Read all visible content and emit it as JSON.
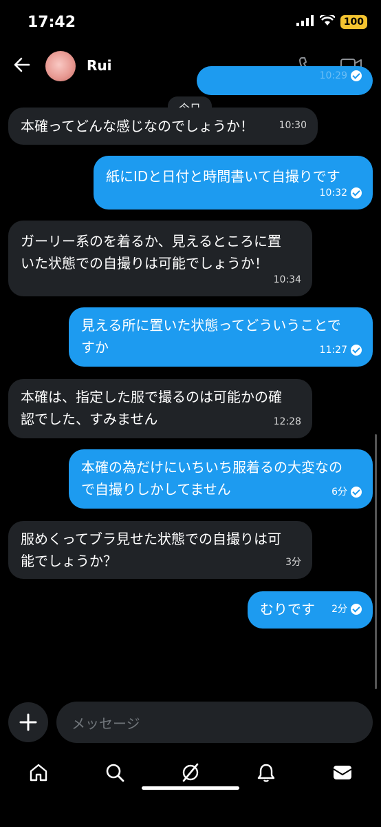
{
  "status_bar": {
    "time": "17:42",
    "battery": "100"
  },
  "header": {
    "contact_name": "Rui"
  },
  "date_divider": "今日",
  "messages": [
    {
      "direction": "out",
      "text": "",
      "time": "10:29",
      "partial": true
    },
    {
      "direction": "in",
      "lines": [
        "本確ってどんな感じなのでしょうか！"
      ],
      "time": "10:30"
    },
    {
      "direction": "out",
      "lines": [
        "紙にIDと日付と時間書いて自撮りです"
      ],
      "time": "10:32",
      "read": true
    },
    {
      "direction": "in",
      "lines": [
        "ガーリー系のを着るか、見えるところに置",
        "いた状態での自撮りは可能でしょうか！"
      ],
      "time": "10:34"
    },
    {
      "direction": "out",
      "lines": [
        "見える所に置いた状態ってどういうことで",
        "すか"
      ],
      "time": "11:27",
      "read": true
    },
    {
      "direction": "in",
      "lines": [
        "本確は、指定した服で撮るのは可能かの確",
        "認でした、すみません"
      ],
      "time": "12:28"
    },
    {
      "direction": "out",
      "lines": [
        "本確の為だけにいちいち服着るの大変なの",
        "で自撮りしかしてません"
      ],
      "time": "6分",
      "read": true
    },
    {
      "direction": "in",
      "lines": [
        "服めくってブラ見せた状態での自撮りは可",
        "能でしょうか？"
      ],
      "time": "3分"
    },
    {
      "direction": "out",
      "lines": [
        "むりです"
      ],
      "time": "2分",
      "read": true
    }
  ],
  "composer": {
    "placeholder": "メッセージ"
  },
  "colors": {
    "outgoing_bubble": "#1d9bf0",
    "incoming_bubble": "#202327",
    "background": "#000000"
  },
  "icons": [
    "back-arrow-icon",
    "phone-icon",
    "video-icon",
    "plus-icon",
    "home-icon",
    "search-icon",
    "grok-icon",
    "bell-icon",
    "mail-icon"
  ]
}
